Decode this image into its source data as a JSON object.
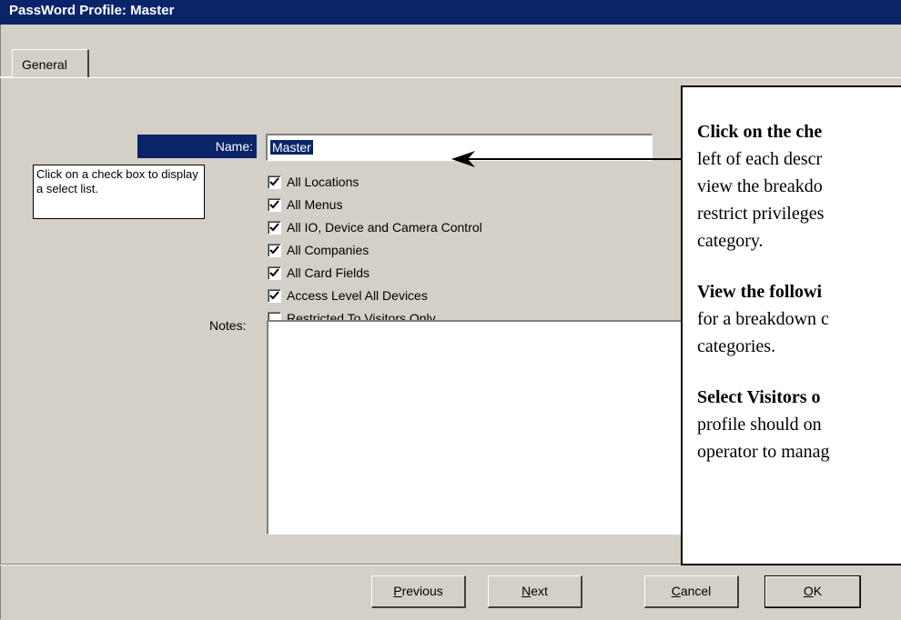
{
  "window": {
    "title": "PassWord Profile: Master"
  },
  "tabs": [
    {
      "label": "General"
    }
  ],
  "form": {
    "name_label": "Name:",
    "name_value": "Master",
    "hint": "Click on a check box to display a select list.",
    "notes_label": "Notes:",
    "notes_value": "",
    "checkboxes": [
      {
        "label": "All Locations",
        "checked": true
      },
      {
        "label": "All Menus",
        "checked": true
      },
      {
        "label": "All IO, Device and Camera Control",
        "checked": true
      },
      {
        "label": "All Companies",
        "checked": true
      },
      {
        "label": "All Card Fields",
        "checked": true
      },
      {
        "label": "Access Level All Devices",
        "checked": true
      },
      {
        "label": "Restricted To Visitors Only",
        "checked": false
      }
    ]
  },
  "buttons": {
    "previous": {
      "first": "P",
      "rest": "revious"
    },
    "next": {
      "first": "N",
      "rest": "ext"
    },
    "cancel": {
      "first": "C",
      "rest": "ancel"
    },
    "ok": {
      "first": "O",
      "rest": "K"
    }
  },
  "callout": {
    "p1_bold": "Click on the che",
    "p1_line2": "left of each descr",
    "p1_line3": "view the breakdo",
    "p1_line4": "restrict privileges",
    "p1_line5": "category.",
    "p2_bold": "View the followi",
    "p2_line2": "for a breakdown c",
    "p2_line3": "categories.",
    "p3_bold": "Select Visitors o",
    "p3_line2": "profile should on",
    "p3_line3": "operator to manag"
  },
  "colors": {
    "titlebar": "#0a246a",
    "face": "#d4d0c8",
    "selection": "#0a246a"
  }
}
